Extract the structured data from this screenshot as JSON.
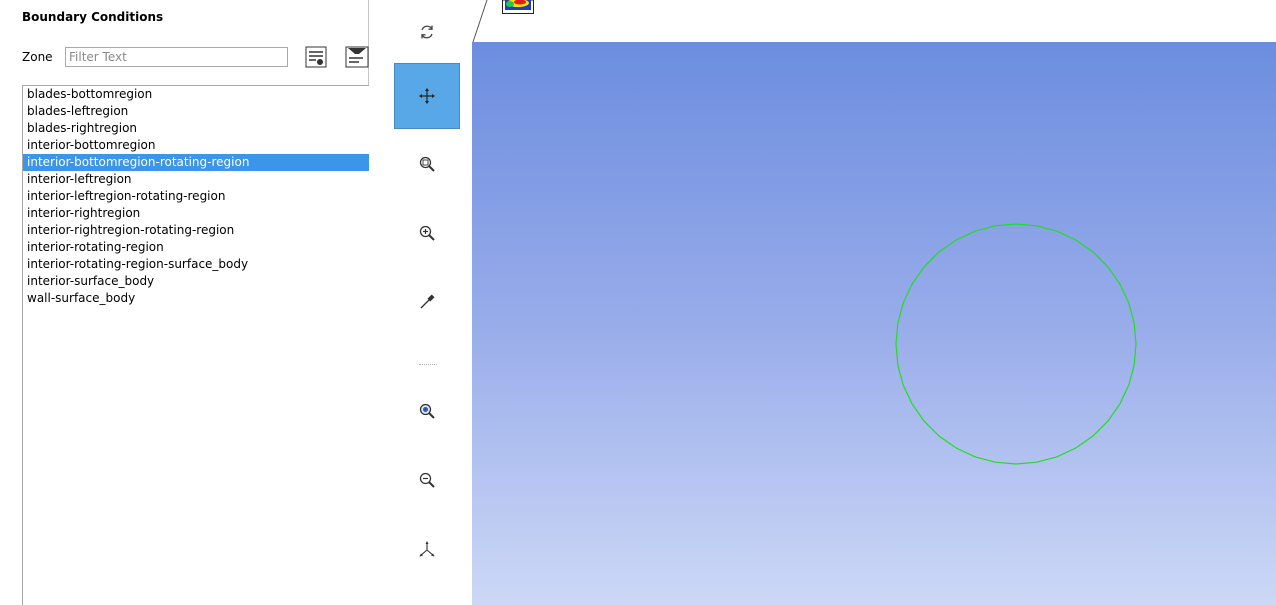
{
  "panel": {
    "title": "Boundary Conditions",
    "zone_label": "Zone",
    "filter_placeholder": "Filter Text",
    "zones": [
      "blades-bottomregion",
      "blades-leftregion",
      "blades-rightregion",
      "interior-bottomregion",
      "interior-bottomregion-rotating-region",
      "interior-leftregion",
      "interior-leftregion-rotating-region",
      "interior-rightregion",
      "interior-rightregion-rotating-region",
      "interior-rotating-region",
      "interior-rotating-region-surface_body",
      "interior-surface_body",
      "wall-surface_body"
    ],
    "selected_zone": "interior-bottomregion-rotating-region",
    "icons": [
      "list-options-icon",
      "filter-icon"
    ]
  },
  "toolbar": {
    "tools": [
      {
        "name": "rotate-icon",
        "active": false
      },
      {
        "name": "pan-icon",
        "active": true
      },
      {
        "name": "zoom-to-area-icon",
        "active": false
      },
      {
        "name": "zoom-in-icon",
        "active": false
      },
      {
        "name": "probe-icon",
        "active": false
      },
      {
        "name": "zoom-fit-icon",
        "active": false
      },
      {
        "name": "zoom-out-icon",
        "active": false
      },
      {
        "name": "axes-icon",
        "active": false
      }
    ]
  },
  "graphics": {
    "gradient_top": "#6c8ddf",
    "gradient_bottom": "#cdd8f6",
    "outline_color": "#22dd22",
    "accent_selected": "#3b95e8",
    "active_tool_color": "#58a8e8"
  }
}
